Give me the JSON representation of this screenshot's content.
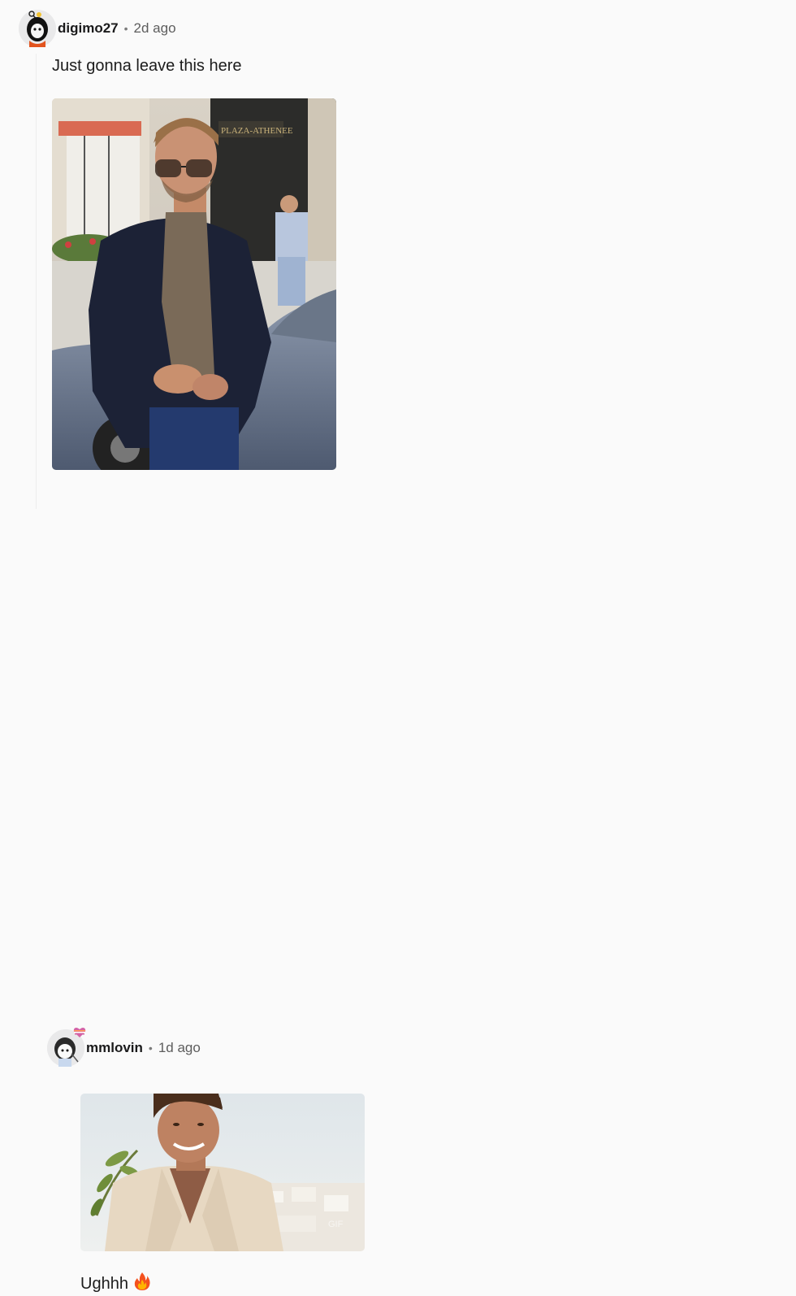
{
  "comments": [
    {
      "username": "digimo27",
      "separator": "•",
      "time": "2d ago",
      "body": "Just gonna leave this here",
      "media": {
        "description_icon": "photo-image",
        "sign_text": "PLAZA-ATHENEE"
      }
    },
    {
      "username": "mmlovin",
      "separator": "•",
      "time": "1d ago",
      "body": "Ughhh",
      "emoji": "🔥",
      "media": {
        "description_icon": "gif-image"
      }
    }
  ],
  "colors": {
    "background": "#fafafa",
    "text": "#1a1a1b",
    "meta": "#5d5d5d"
  }
}
